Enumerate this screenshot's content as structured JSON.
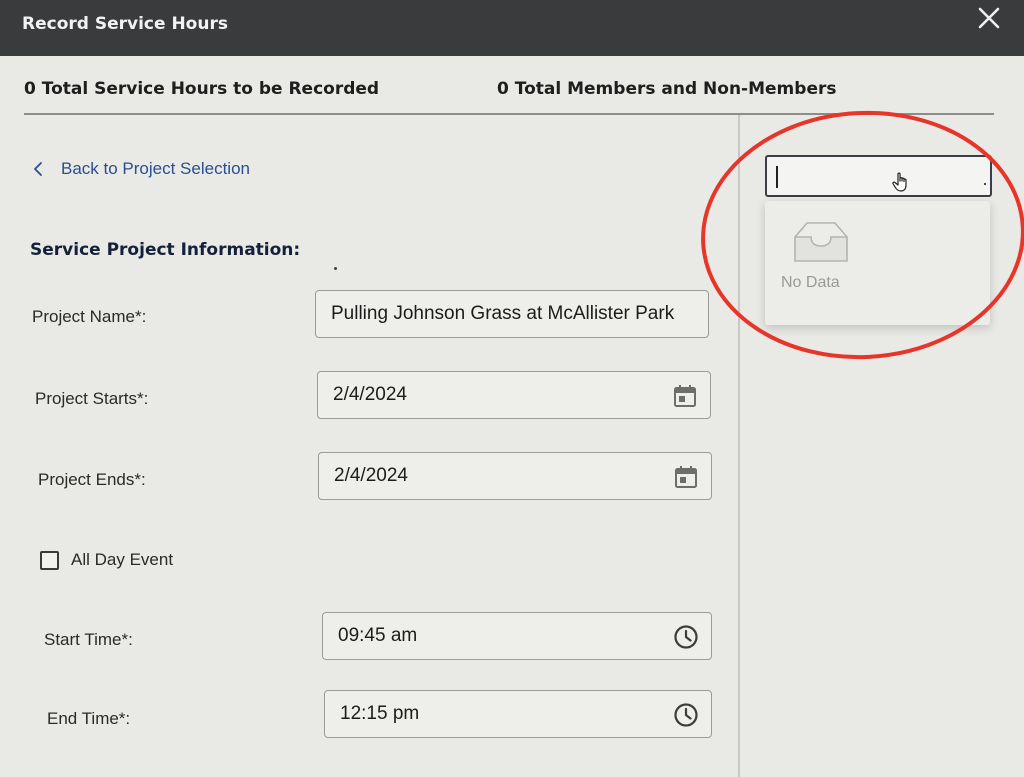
{
  "dialog": {
    "title": "Record Service Hours",
    "close_icon": "close-icon"
  },
  "totals": {
    "hours": "0 Total Service Hours to be Recorded",
    "members": "0 Total Members and Non-Members"
  },
  "nav": {
    "back_label": "Back to Project Selection",
    "back_icon": "chevron-left-icon"
  },
  "section": {
    "title": "Service Project Information:"
  },
  "form": {
    "project_name_label": "Project Name*:",
    "project_name_value": "Pulling Johnson Grass at McAllister Park",
    "project_starts_label": "Project Starts*:",
    "project_starts_value": "2/4/2024",
    "project_ends_label": "Project Ends*:",
    "project_ends_value": "2/4/2024",
    "all_day_label": "All Day Event",
    "all_day_checked": false,
    "start_time_label": "Start Time*:",
    "start_time_value": "09:45 am",
    "end_time_label": "End Time*:",
    "end_time_value": "12:15 pm",
    "date_icon": "calendar-icon",
    "time_icon": "clock-icon"
  },
  "member_select": {
    "value": "",
    "empty_text": "No Data",
    "empty_icon": "empty-inbox-icon"
  },
  "colors": {
    "titlebar": "#3a3b3d",
    "link": "#2a4f8f",
    "annotation": "#e8352a"
  }
}
